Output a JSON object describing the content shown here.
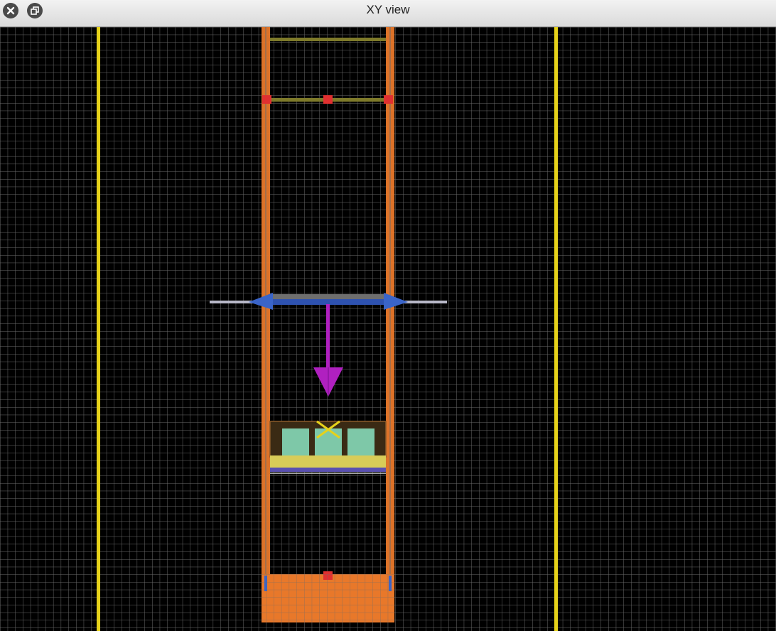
{
  "window": {
    "title": "XY view",
    "close_icon": "close-icon",
    "restore_icon": "restore-window-icon"
  },
  "viewport": {
    "background_color": "#000000",
    "grid_color": "#6a6a6a",
    "guide_line_color": "#e6d21a",
    "wall_color": "#e8782a",
    "beam_color": "#7e7a2a",
    "handle_color": "#e03030",
    "manipulator_color": "#3a64c8",
    "gravity_arrow_color": "#b020c0",
    "platform_color": "#d8cc58",
    "crate_color": "#7ec8a8"
  }
}
